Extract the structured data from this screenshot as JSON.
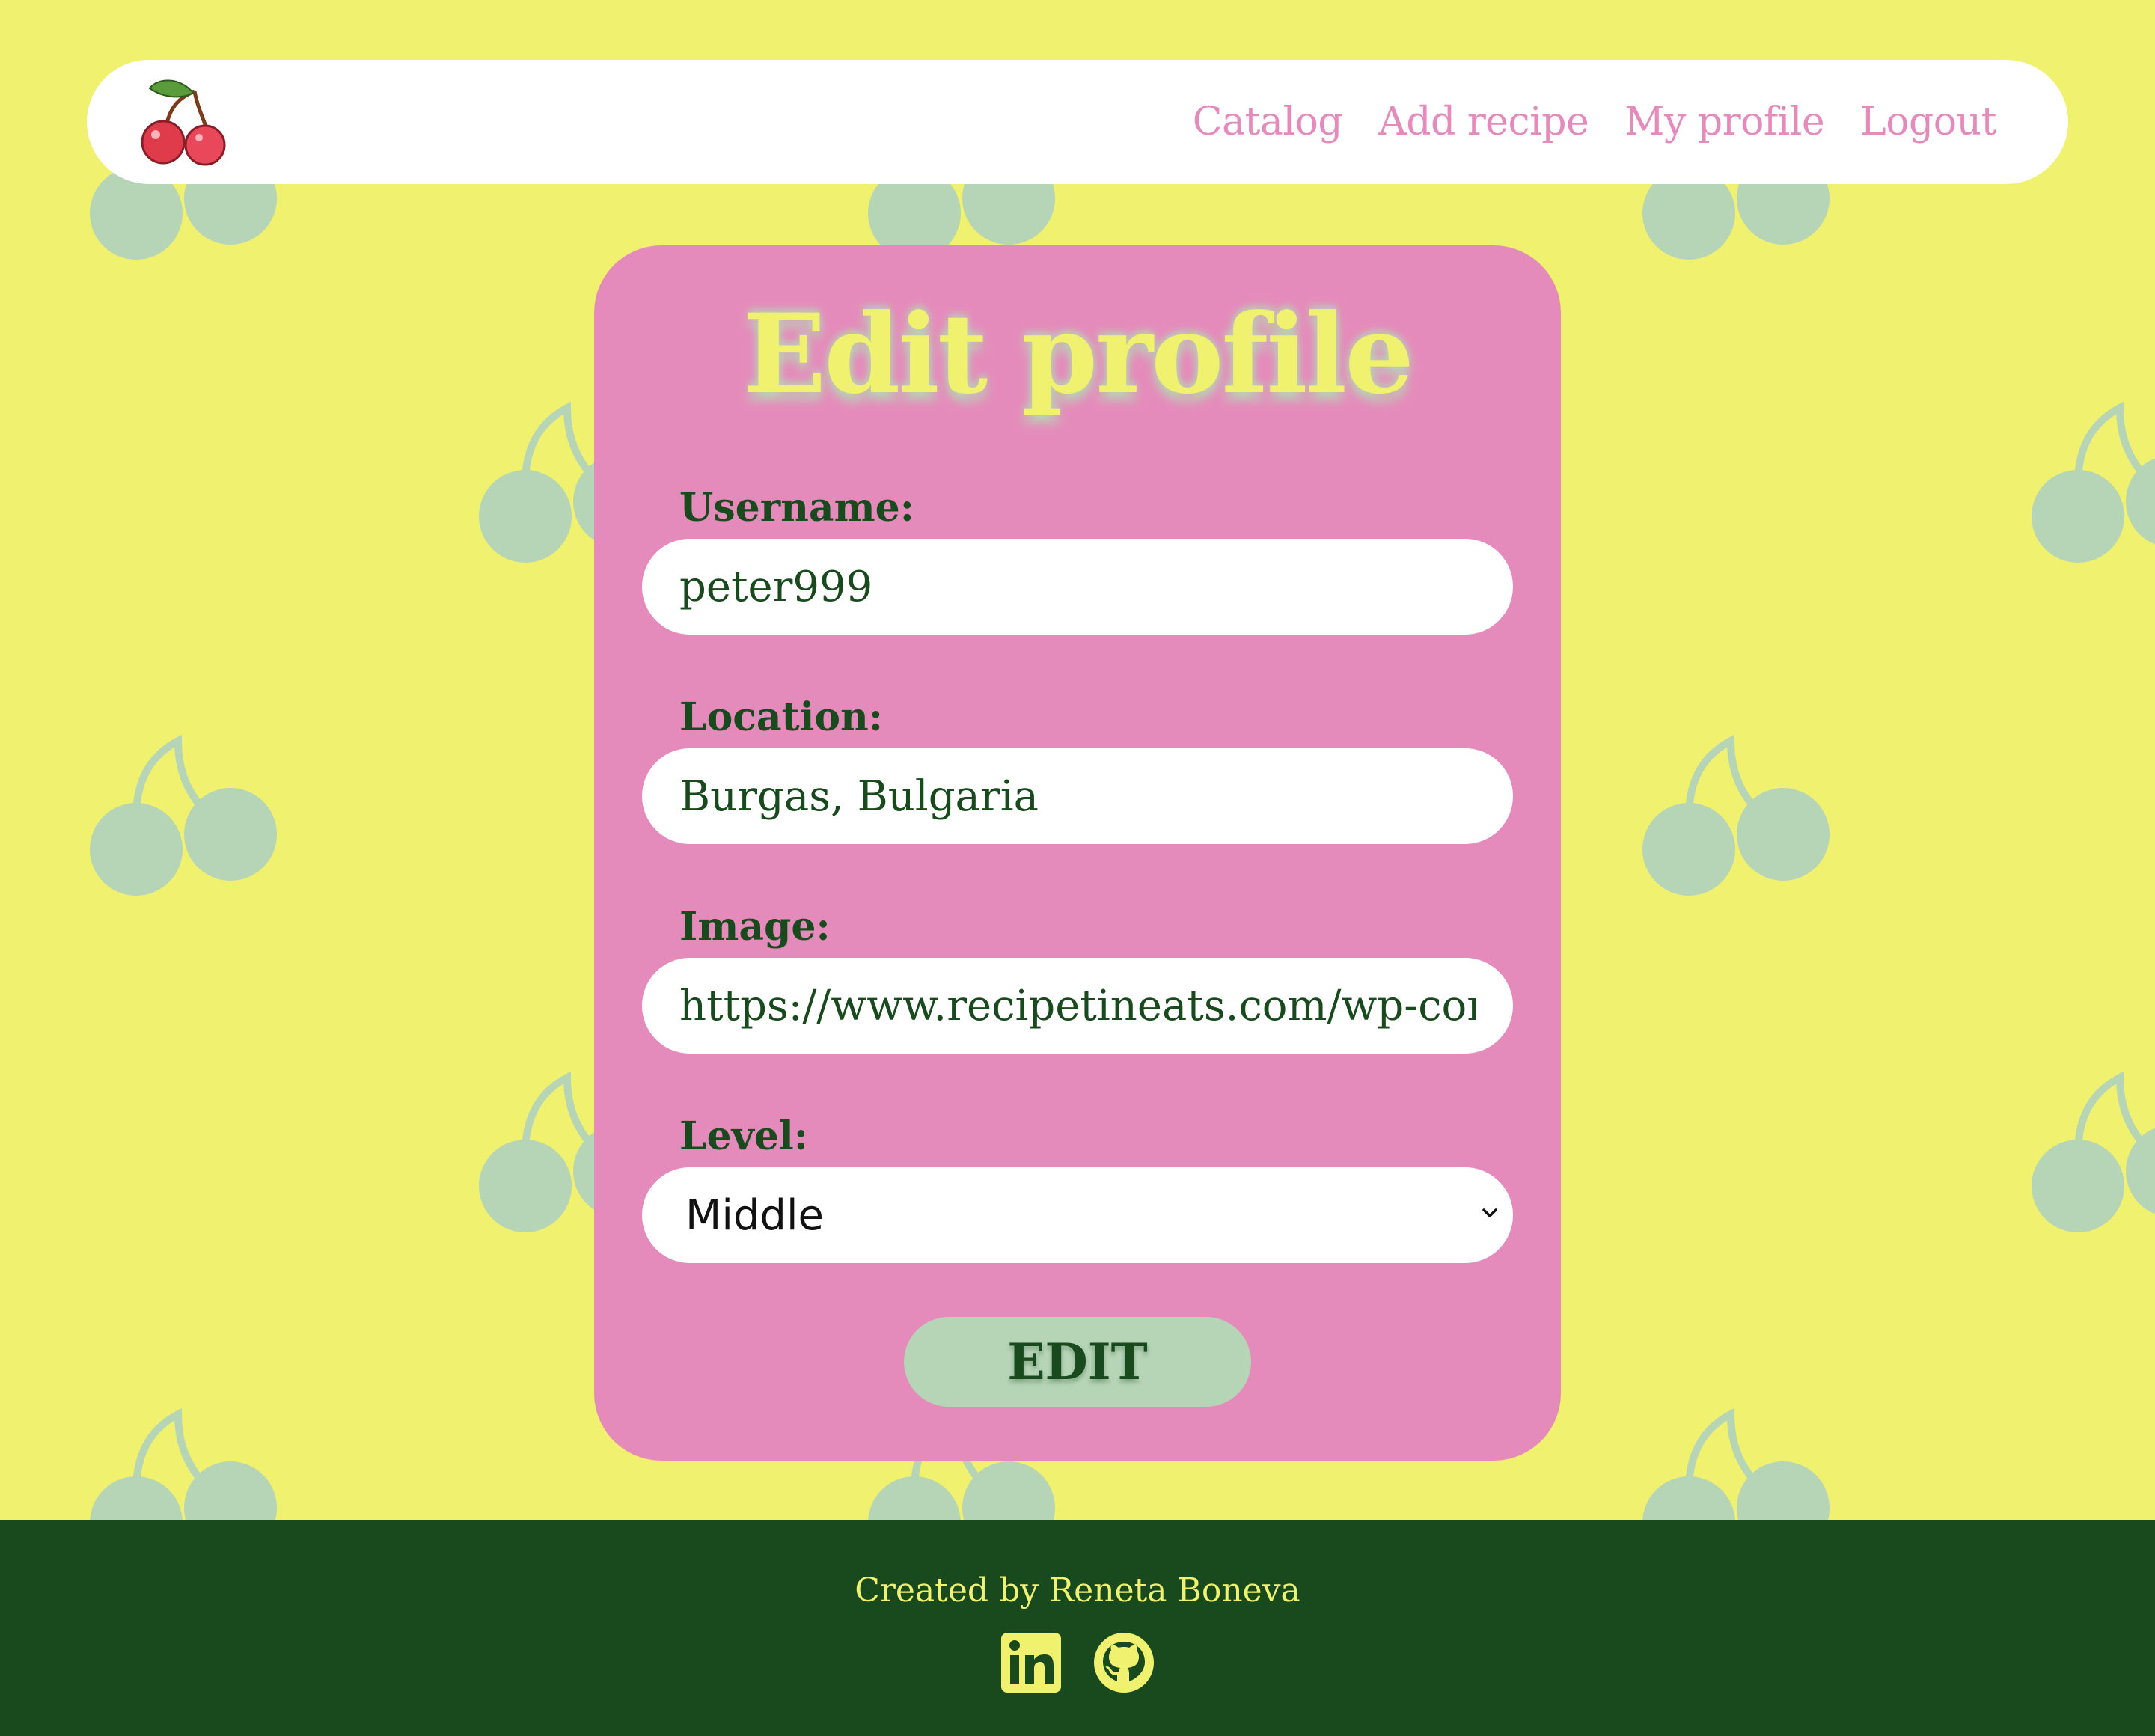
{
  "header": {
    "logo": "cherry-logo-icon",
    "nav": [
      {
        "label": "Catalog"
      },
      {
        "label": "Add recipe"
      },
      {
        "label": "My profile"
      },
      {
        "label": "Logout"
      }
    ]
  },
  "form": {
    "title": "Edit profile",
    "username": {
      "label": "Username:",
      "value": "peter999"
    },
    "location": {
      "label": "Location:",
      "value": "Burgas, Bulgaria"
    },
    "image": {
      "label": "Image:",
      "value": "https://www.recipetineats.com/wp-conter"
    },
    "level": {
      "label": "Level:",
      "value": "Middle"
    },
    "submit_label": "EDIT"
  },
  "footer": {
    "credit": "Created by Reneta Boneva",
    "icons": [
      "linkedin-icon",
      "github-icon"
    ]
  },
  "colors": {
    "background": "#eff16f",
    "card": "#e58bbb",
    "accent_dark": "#184a1e",
    "button": "#b6d4b6",
    "pattern": "#b6d4b6"
  }
}
